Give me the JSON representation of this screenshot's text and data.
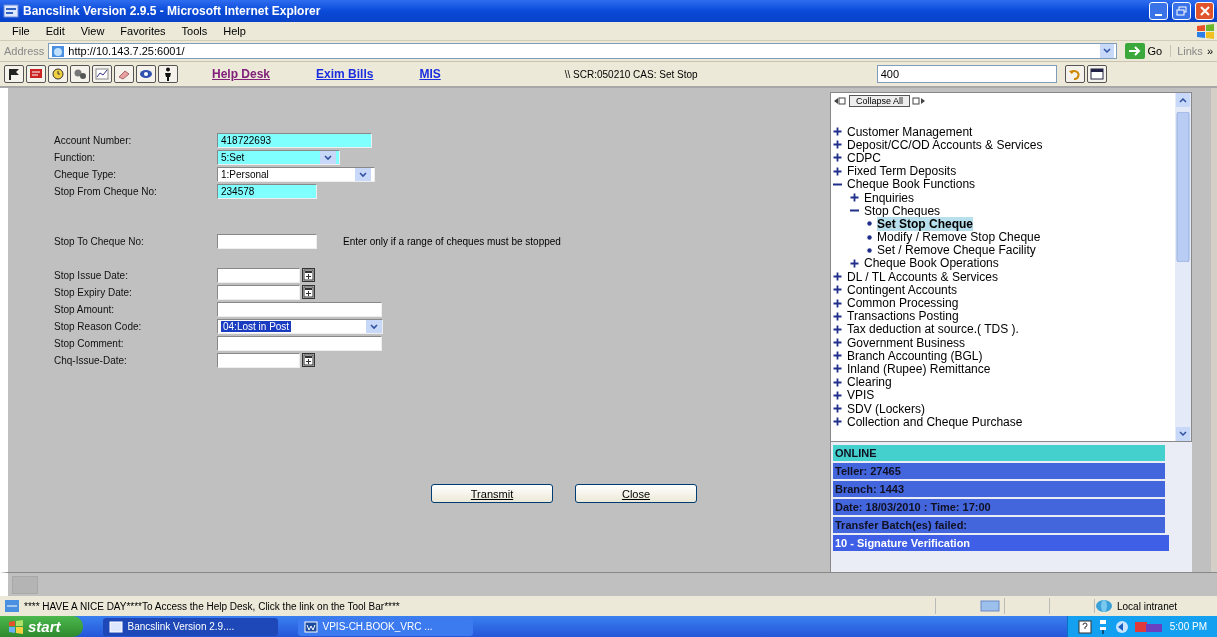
{
  "window": {
    "title": "Bancslink Version 2.9.5 - Microsoft Internet Explorer"
  },
  "menu": [
    "File",
    "Edit",
    "View",
    "Favorites",
    "Tools",
    "Help"
  ],
  "address_bar": {
    "label": "Address",
    "url": "http://10.143.7.25:6001/",
    "go": "Go",
    "links": "Links",
    "more": "»"
  },
  "app_toolbar": {
    "links": [
      {
        "label": "Help Desk",
        "visited": true
      },
      {
        "label": "Exim Bills",
        "visited": false
      },
      {
        "label": "MIS",
        "visited": false
      }
    ],
    "screen_path": "\\\\ SCR:050210 CAS: Set Stop",
    "code_field": "400"
  },
  "form": {
    "groups": [
      [
        {
          "label": "Account Number:",
          "kind": "text",
          "value": "418722693",
          "highlighted": true
        },
        {
          "label": "Function:",
          "kind": "select",
          "value": "5:Set",
          "highlighted": true
        },
        {
          "label": "Cheque Type:",
          "kind": "select",
          "value": "1:Personal",
          "highlighted": false
        },
        {
          "label": "Stop From Cheque No:",
          "kind": "text",
          "value": "234578",
          "highlighted": true
        }
      ],
      [
        {
          "label": "Stop To Cheque No:",
          "kind": "text",
          "highlighted": false,
          "hint": "Enter only if a range of cheques must be stopped"
        }
      ],
      [
        {
          "label": "Stop Issue Date:",
          "kind": "date",
          "highlighted": false
        },
        {
          "label": "Stop Expiry Date:",
          "kind": "date",
          "highlighted": false
        },
        {
          "label": "Stop Amount:",
          "kind": "text",
          "highlighted": false
        },
        {
          "label": "Stop Reason Code:",
          "kind": "select",
          "value": "04:Lost in Post",
          "highlighted": false,
          "focused": true
        },
        {
          "label": "Stop Comment:",
          "kind": "text",
          "highlighted": false
        },
        {
          "label": "Chq-Issue-Date:",
          "kind": "date",
          "highlighted": false
        }
      ]
    ],
    "buttons": [
      "Transmit",
      "Close"
    ]
  },
  "menu_tree": {
    "collapse_button": "Collapse All",
    "items": [
      {
        "label": "Customer Management",
        "kind": "folder",
        "expanded": false,
        "selected": false
      },
      {
        "label": "Deposit/CC/OD Accounts & Services",
        "kind": "folder",
        "expanded": false,
        "selected": false
      },
      {
        "label": "CDPC",
        "kind": "folder",
        "expanded": false,
        "selected": false
      },
      {
        "label": "Fixed Term Deposits",
        "kind": "folder",
        "expanded": false,
        "selected": false
      },
      {
        "label": "Cheque Book Functions",
        "kind": "folder",
        "expanded": true,
        "selected": false,
        "children": [
          {
            "label": "Enquiries",
            "kind": "folder",
            "expanded": false,
            "selected": false
          },
          {
            "label": "Stop Cheques",
            "kind": "folder",
            "expanded": true,
            "selected": false,
            "children": [
              {
                "label": "Set Stop Cheque",
                "kind": "leaf",
                "selected": true
              },
              {
                "label": "Modify / Remove Stop Cheque",
                "kind": "leaf",
                "selected": false
              },
              {
                "label": "Set / Remove Cheque Facility",
                "kind": "leaf",
                "selected": false
              }
            ]
          },
          {
            "label": "Cheque Book Operations",
            "kind": "folder",
            "expanded": false,
            "selected": false
          }
        ]
      },
      {
        "label": "DL / TL Accounts & Services",
        "kind": "folder",
        "expanded": false,
        "selected": false
      },
      {
        "label": "Contingent Accounts",
        "kind": "folder",
        "expanded": false,
        "selected": false
      },
      {
        "label": "Common Processing",
        "kind": "folder",
        "expanded": false,
        "selected": false
      },
      {
        "label": "Transactions Posting",
        "kind": "folder",
        "expanded": false,
        "selected": false
      },
      {
        "label": "Tax deduction at source.( TDS ).",
        "kind": "folder",
        "expanded": false,
        "selected": false
      },
      {
        "label": "Government Business",
        "kind": "folder",
        "expanded": false,
        "selected": false
      },
      {
        "label": "Branch Accounting (BGL)",
        "kind": "folder",
        "expanded": false,
        "selected": false
      },
      {
        "label": "Inland (Rupee) Remittance",
        "kind": "folder",
        "expanded": false,
        "selected": false
      },
      {
        "label": "Clearing",
        "kind": "folder",
        "expanded": false,
        "selected": false
      },
      {
        "label": "VPIS",
        "kind": "folder",
        "expanded": false,
        "selected": false
      },
      {
        "label": "SDV (Lockers)",
        "kind": "folder",
        "expanded": false,
        "selected": false
      },
      {
        "label": "Collection and Cheque Purchase",
        "kind": "folder",
        "expanded": false,
        "selected": false
      }
    ]
  },
  "session_info": [
    {
      "text": "ONLINE",
      "color": "#44d0cc"
    },
    {
      "text": "Teller: 27465",
      "color": "#4466dd"
    },
    {
      "text": "Branch: 1443",
      "color": "#4466dd"
    },
    {
      "text": "Date: 18/03/2010 : Time: 17:00",
      "color": "#4466dd"
    },
    {
      "text": "Transfer Batch(es) failed:",
      "color": "#4466dd"
    },
    {
      "text": "10 - Signature Verification",
      "color": "#3f5fe6"
    }
  ],
  "status_bar": {
    "message": "**** HAVE A NICE DAY****To Access the Help Desk, Click the link on the Tool Bar****",
    "zone": "Local intranet"
  },
  "taskbar": {
    "start": "start",
    "tasks": [
      {
        "label": "Bancslink Version 2.9....",
        "selected": true
      },
      {
        "label": "VPIS-CH.BOOK_VRC ...",
        "selected": false
      }
    ],
    "clock": "5:00 PM"
  }
}
